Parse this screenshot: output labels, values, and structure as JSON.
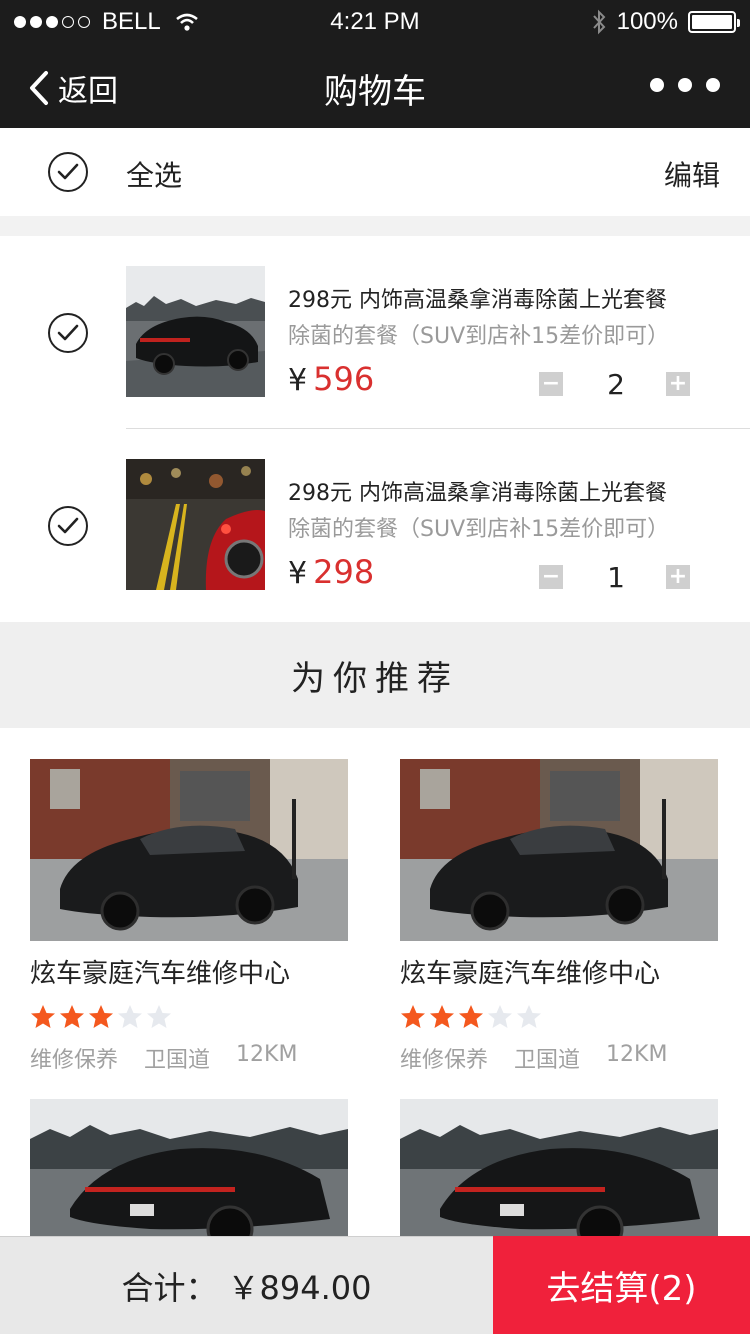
{
  "status_bar": {
    "carrier": "BELL",
    "time": "4:21 PM",
    "battery": "100%"
  },
  "nav": {
    "back_label": "返回",
    "title": "购物车"
  },
  "select_bar": {
    "select_all": "全选",
    "edit": "编辑"
  },
  "cart_items": [
    {
      "title": "298元 内饰高温桑拿消毒除菌上光套餐",
      "subtitle": "除菌的套餐（SUV到店补15差价即可）",
      "currency": "¥",
      "price": "596",
      "quantity": "2"
    },
    {
      "title": "298元 内饰高温桑拿消毒除菌上光套餐",
      "subtitle": "除菌的套餐（SUV到店补15差价即可）",
      "currency": "¥",
      "price": "298",
      "quantity": "1"
    }
  ],
  "recommend": {
    "heading": "为你推荐",
    "items": [
      {
        "name": "炫车豪庭汽车维修中心",
        "rating": 3,
        "max_rating": 5,
        "category": "维修保养",
        "location": "卫国道",
        "distance": "12KM"
      },
      {
        "name": "炫车豪庭汽车维修中心",
        "rating": 3,
        "max_rating": 5,
        "category": "维修保养",
        "location": "卫国道",
        "distance": "12KM"
      }
    ]
  },
  "bottom": {
    "total_label": "合计：",
    "total_value": "￥894.00",
    "checkout_label": "去结算(2)"
  },
  "colors": {
    "price_red": "#d9302f",
    "checkout_red": "#f0213b",
    "star_orange": "#f4581e",
    "header_dark": "#1c1c1c"
  }
}
